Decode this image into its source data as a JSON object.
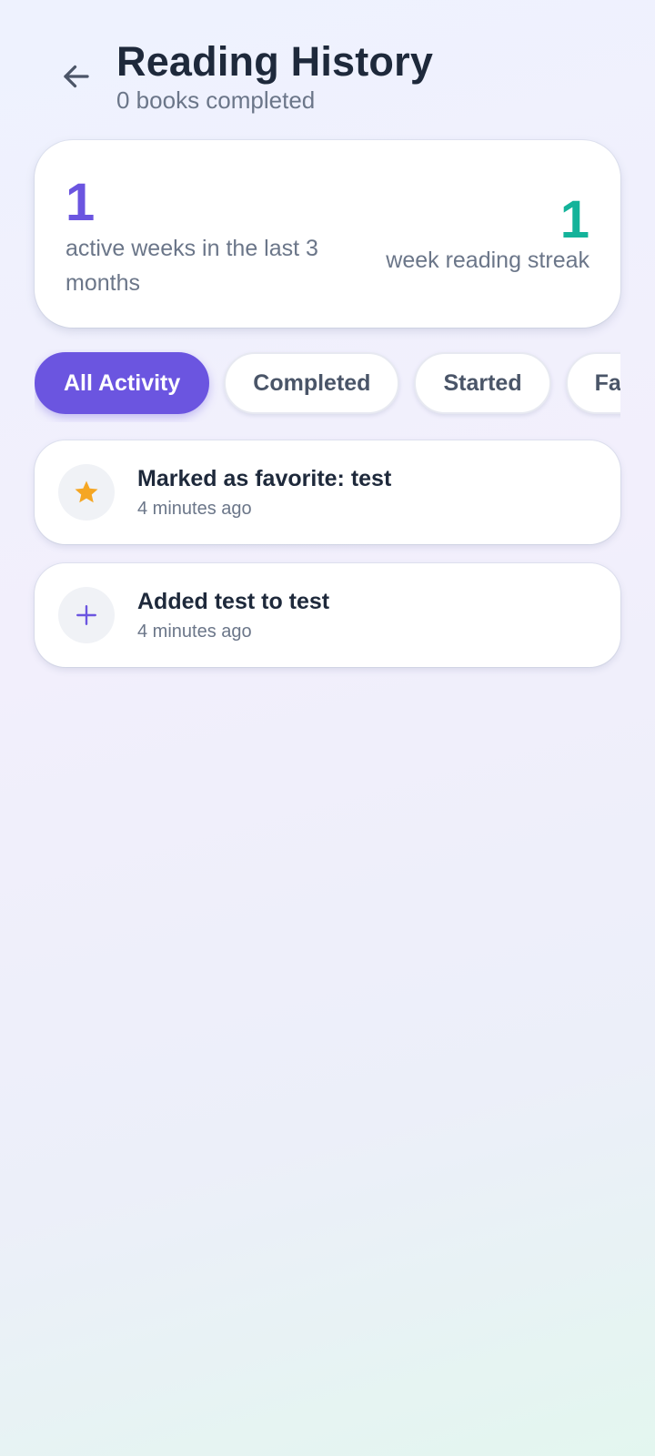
{
  "header": {
    "title": "Reading History",
    "subtitle": "0 books completed",
    "back_icon": "arrow-left-icon"
  },
  "stats": {
    "active_weeks": {
      "value": "1",
      "label": "active weeks in the last 3 months"
    },
    "streak": {
      "value": "1",
      "label": "week reading streak"
    }
  },
  "filters": {
    "selected": "All Activity",
    "items": [
      {
        "label": "All Activity"
      },
      {
        "label": "Completed"
      },
      {
        "label": "Started"
      },
      {
        "label": "Favorites"
      }
    ]
  },
  "activities": [
    {
      "icon": "star-icon",
      "title": "Marked as favorite: test",
      "time": "4 minutes ago"
    },
    {
      "icon": "plus-icon",
      "title": "Added test to test",
      "time": "4 minutes ago"
    }
  ],
  "colors": {
    "accent": "#6b55e0",
    "streak": "#14b39a",
    "star": "#f5a623"
  }
}
